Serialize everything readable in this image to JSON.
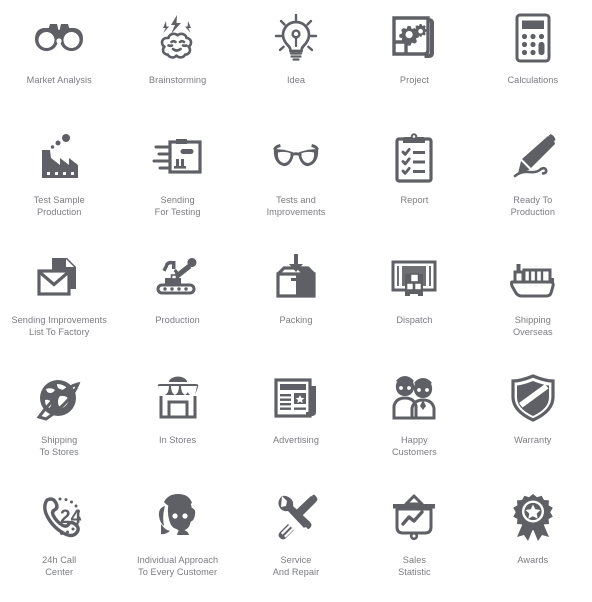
{
  "theme": {
    "background": "#ffffff",
    "icon_color": "#5f6065",
    "label_color": "#7b7c81"
  },
  "grid": {
    "columns": 5,
    "rows": 5
  },
  "icons": [
    {
      "id": "market-analysis",
      "icon": "binoculars-icon",
      "label": "Market Analysis"
    },
    {
      "id": "brainstorming",
      "icon": "brain-lightning-icon",
      "label": "Brainstorming"
    },
    {
      "id": "idea",
      "icon": "lightbulb-icon",
      "label": "Idea"
    },
    {
      "id": "project",
      "icon": "blueprint-gears-icon",
      "label": "Project"
    },
    {
      "id": "calculations",
      "icon": "calculator-icon",
      "label": "Calculations"
    },
    {
      "id": "test-sample-production",
      "icon": "factory-icon",
      "label": "Test Sample\nProduction"
    },
    {
      "id": "sending-for-testing",
      "icon": "flying-package-icon",
      "label": "Sending\nFor Testing"
    },
    {
      "id": "tests-and-improvements",
      "icon": "glasses-icon",
      "label": "Tests and\nImprovements"
    },
    {
      "id": "report",
      "icon": "clipboard-check-icon",
      "label": "Report"
    },
    {
      "id": "ready-to-production",
      "icon": "pen-signature-icon",
      "label": "Ready To\nProduction"
    },
    {
      "id": "sending-improvements-list",
      "icon": "envelope-document-icon",
      "label": "Sending Improvements\nList To Factory"
    },
    {
      "id": "production",
      "icon": "robot-arm-conveyor-icon",
      "label": "Production"
    },
    {
      "id": "packing",
      "icon": "box-arrow-down-icon",
      "label": "Packing"
    },
    {
      "id": "dispatch",
      "icon": "truck-rear-boxes-icon",
      "label": "Dispatch"
    },
    {
      "id": "shipping-overseas",
      "icon": "cargo-ship-icon",
      "label": "Shipping\nOverseas"
    },
    {
      "id": "shipping-to-stores",
      "icon": "globe-orbit-icon",
      "label": "Shipping\nTo Stores"
    },
    {
      "id": "in-stores",
      "icon": "storefront-icon",
      "label": "In Stores"
    },
    {
      "id": "advertising",
      "icon": "newspaper-icon",
      "label": "Advertising"
    },
    {
      "id": "happy-customers",
      "icon": "two-people-icon",
      "label": "Happy\nCustomers"
    },
    {
      "id": "warranty",
      "icon": "shield-icon",
      "label": "Warranty"
    },
    {
      "id": "call-center",
      "icon": "phone-24h-icon",
      "label": "24h Call\nCenter"
    },
    {
      "id": "individual-approach",
      "icon": "headset-woman-icon",
      "label": "Individual Approach\nTo Every Customer"
    },
    {
      "id": "service-and-repair",
      "icon": "wrench-screwdriver-icon",
      "label": "Service\nAnd Repair"
    },
    {
      "id": "sales-statistic",
      "icon": "presentation-chart-icon",
      "label": "Sales\nStatistic"
    },
    {
      "id": "awards",
      "icon": "award-ribbon-icon",
      "label": "Awards"
    }
  ]
}
